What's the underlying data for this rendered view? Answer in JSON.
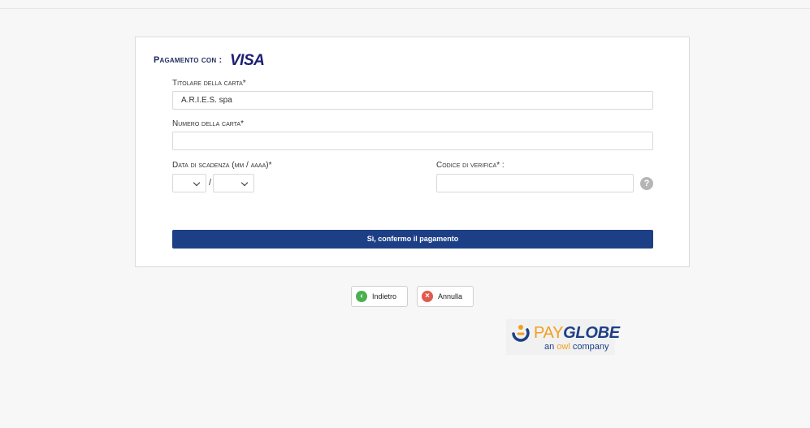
{
  "form": {
    "pay_with_label": "Pagamento con :",
    "card_brand": "VISA",
    "holder_label": "Titolare della carta*",
    "holder_value": "A.R.I.E.S. spa",
    "number_label": "Numero della carta*",
    "number_value": "",
    "expiry_label": "Data di scadenza (mm / aaaa)*",
    "expiry_separator": "/",
    "cvv_label": "Codice di verifica* :",
    "cvv_value": "",
    "help_symbol": "?",
    "confirm_label": "Sì, confermo il pagamento"
  },
  "nav": {
    "back_label": "Indietro",
    "back_icon": "chevron-left-icon",
    "cancel_label": "Annulla",
    "cancel_icon": "close-icon"
  },
  "brand": {
    "pay": "PAY",
    "globe": "GLOBE",
    "tagline_a": "an ",
    "tagline_owl": "owl",
    "tagline_b": " company"
  },
  "colors": {
    "primary": "#1d3f86",
    "visa_blue": "#1a1f71",
    "back_green": "#4caf50",
    "cancel_red": "#e05a4f",
    "brand_orange": "#f29f1f"
  }
}
